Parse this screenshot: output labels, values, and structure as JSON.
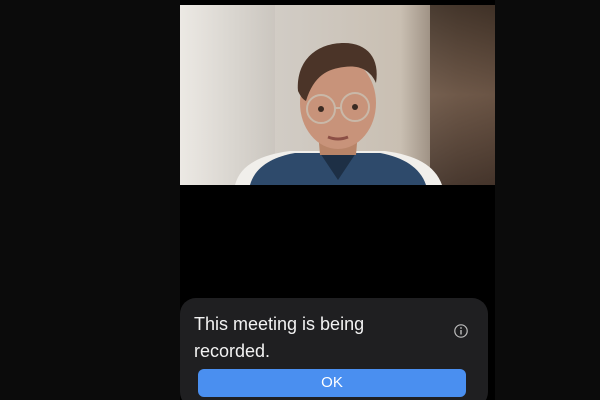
{
  "notice": {
    "message": "This meeting is being recorded.",
    "info_icon": "info-icon",
    "ok_label": "OK"
  },
  "video": {
    "description_icon": "participant-video"
  },
  "colors": {
    "dialog_bg": "#1f1f21",
    "button_bg": "#4a8ff0",
    "text": "#f2f2f2"
  }
}
